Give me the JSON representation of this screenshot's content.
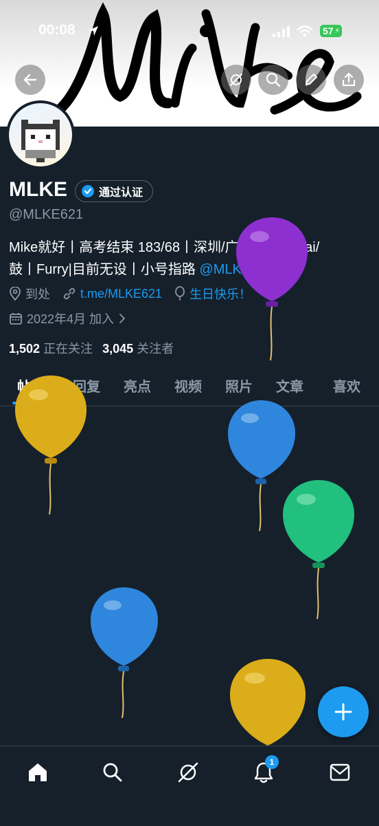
{
  "status_bar": {
    "time": "00:08",
    "battery": "57"
  },
  "profile": {
    "name": "MLKE",
    "verified_label": "通过认证",
    "handle": "@MLKE621",
    "bio_line1": "Mike就好丨高考结束 183/68丨深圳/广州丨音游mai/",
    "bio_line2_prefix": "鼓丨Furry|目前无设丨小号指路 ",
    "bio_mention": "@MLKE139115",
    "location": "到处",
    "website": "t.me/MLKE621",
    "birthday": "生日快乐！",
    "joined": "2022年4月 加入",
    "following_count": "1,502",
    "following_label": "正在关注",
    "followers_count": "3,045",
    "followers_label": "关注者"
  },
  "banner_text": "Mike",
  "tabs": [
    "帖子",
    "回复",
    "亮点",
    "视频",
    "照片",
    "文章",
    "喜欢"
  ],
  "notifications_badge": "1",
  "icons": {
    "back": "arrow-left-icon",
    "grok": "grok-icon",
    "search": "search-icon",
    "edit": "pencil-icon",
    "share": "share-icon",
    "home": "home-icon",
    "explore": "search-icon",
    "notifications": "bell-icon",
    "messages": "mail-icon",
    "compose": "plus-icon"
  },
  "colors": {
    "accent": "#1d9bf0",
    "background": "#15202b",
    "verified": "#1d9bf0"
  },
  "balloons": [
    "yellow",
    "purple",
    "blue",
    "green",
    "blue",
    "yellow"
  ]
}
